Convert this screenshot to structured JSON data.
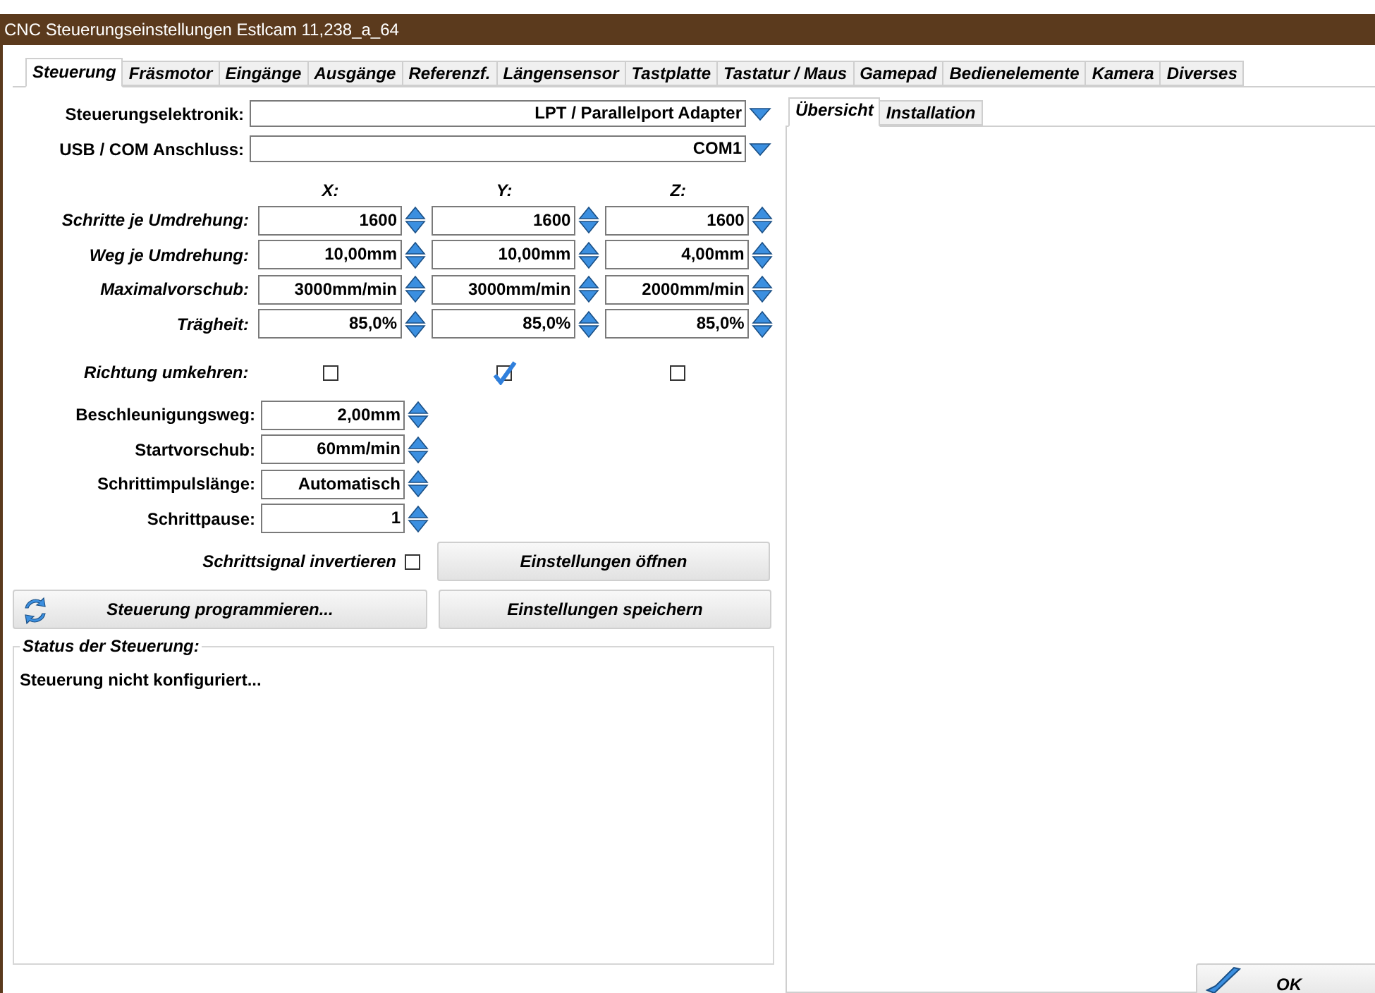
{
  "window": {
    "title": "CNC Steuerungseinstellungen Estlcam 11,238_a_64"
  },
  "tabs": [
    {
      "label": "Steuerung",
      "selected": true
    },
    {
      "label": "Fräsmotor",
      "selected": false
    },
    {
      "label": "Eingänge",
      "selected": false
    },
    {
      "label": "Ausgänge",
      "selected": false
    },
    {
      "label": "Referenzf.",
      "selected": false
    },
    {
      "label": "Längensensor",
      "selected": false
    },
    {
      "label": "Tastplatte",
      "selected": false
    },
    {
      "label": "Tastatur / Maus",
      "selected": false
    },
    {
      "label": "Gamepad",
      "selected": false
    },
    {
      "label": "Bedienelemente",
      "selected": false
    },
    {
      "label": "Kamera",
      "selected": false
    },
    {
      "label": "Diverses",
      "selected": false
    }
  ],
  "selects": [
    {
      "label": "Steuerungselektronik:",
      "value": "LPT / Parallelport Adapter"
    },
    {
      "label": "USB / COM Anschluss:",
      "value": "COM1"
    }
  ],
  "axes": [
    "X:",
    "Y:",
    "Z:"
  ],
  "axis_rows": [
    {
      "label": "Schritte je Umdrehung:",
      "values": [
        "1600",
        "1600",
        "1600"
      ]
    },
    {
      "label": "Weg je Umdrehung:",
      "values": [
        "10,00mm",
        "10,00mm",
        "4,00mm"
      ]
    },
    {
      "label": "Maximalvorschub:",
      "values": [
        "3000mm/min",
        "3000mm/min",
        "2000mm/min"
      ]
    },
    {
      "label": "Trägheit:",
      "values": [
        "85,0%",
        "85,0%",
        "85,0%"
      ]
    }
  ],
  "reverse": {
    "label": "Richtung umkehren:",
    "checked": [
      false,
      true,
      false
    ]
  },
  "single_rows": [
    {
      "label": "Beschleunigungsweg:",
      "value": "2,00mm"
    },
    {
      "label": "Startvorschub:",
      "value": "60mm/min"
    },
    {
      "label": "Schrittimpulslänge:",
      "value": "Automatisch"
    },
    {
      "label": "Schrittpause:",
      "value": "1"
    }
  ],
  "invert_signal": {
    "label": "Schrittsignal invertieren",
    "checked": false
  },
  "buttons": {
    "open": "Einstellungen öffnen",
    "program": "Steuerung programmieren...",
    "save": "Einstellungen speichern"
  },
  "status": {
    "title": "Status der Steuerung:",
    "text": "Steuerung nicht konfiguriert..."
  },
  "side_tabs": [
    {
      "label": "Übersicht",
      "selected": true
    },
    {
      "label": "Installation",
      "selected": false
    }
  ],
  "ok": "OK"
}
